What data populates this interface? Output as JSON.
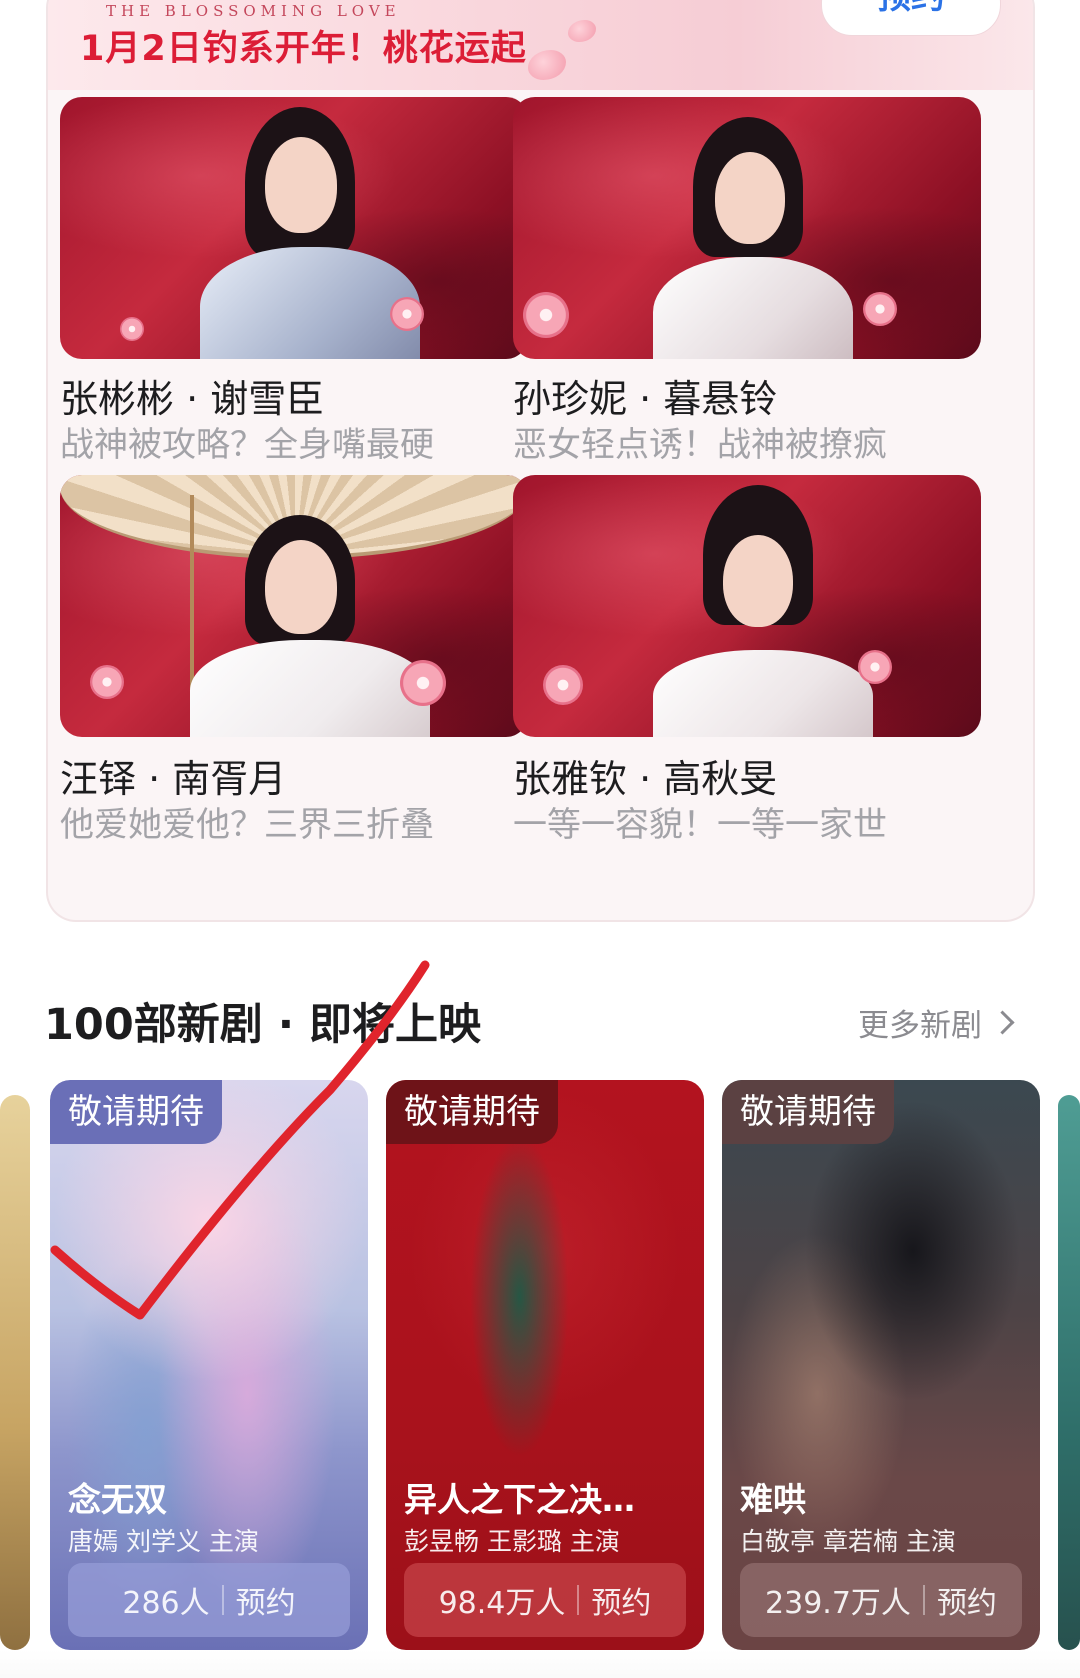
{
  "promo": {
    "banner_subtitle": "THE BLOSSOMING LOVE",
    "banner_title": "1月2日钓系开年！桃花运起",
    "reserve_button": "预约",
    "cast": [
      {
        "name": "张彬彬 · 谢雪臣",
        "tagline": "战神被攻略？全身嘴最硬"
      },
      {
        "name": "孙珍妮 · 暮悬铃",
        "tagline": "恶女轻点诱！战神被撩疯"
      },
      {
        "name": "汪铎 · 南胥月",
        "tagline": "他爱她爱他？三界三折叠"
      },
      {
        "name": "张雅钦 · 高秋旻",
        "tagline": "一等一容貌！一等一家世"
      }
    ]
  },
  "upcoming": {
    "section_title": "100部新剧 · 即将上映",
    "more_label": "更多新剧",
    "dramas": [
      {
        "badge": "敬请期待",
        "title": "念无双",
        "cast": "唐嫣 刘学义 主演",
        "count": "286人",
        "action": "预约"
      },
      {
        "badge": "敬请期待",
        "title": "异人之下之决…",
        "cast": "彭昱畅 王影璐 主演",
        "count": "98.4万人",
        "action": "预约"
      },
      {
        "badge": "敬请期待",
        "title": "难哄",
        "cast": "白敬亭 章若楠 主演",
        "count": "239.7万人",
        "action": "预约"
      }
    ]
  },
  "icons": [
    "chevron-right-icon"
  ],
  "colors": {
    "banner_title": "#dc1d36",
    "reserve_text": "#2b72e6",
    "card1_tint": "#6c72b8",
    "card2_tint": "#a51d2a",
    "card3_tint": "#6e4a4a",
    "annotation": "#e0242c"
  }
}
